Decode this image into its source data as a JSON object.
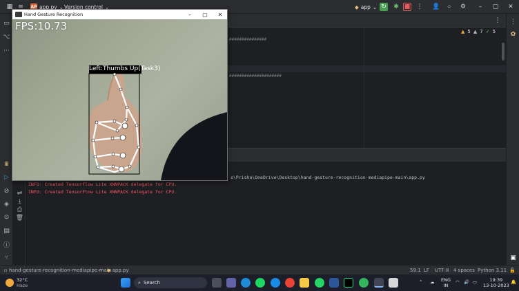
{
  "ide": {
    "project_name": "app.py",
    "project_badge": "AP",
    "version_control": "Version control",
    "run_config": "app",
    "inspections": {
      "warnings": "5",
      "weak_warnings": "7",
      "other": "5"
    }
  },
  "editor": {
    "code_lines": [
      "###############",
      "#####################"
    ]
  },
  "console": {
    "path_line": "s\\Prisha\\OneDrive\\Desktop\\hand-gesture-recognition-mediapipe-main\\app.py",
    "lines": [
      "INFO: Created TensorFlow Lite XNNPACK delegate for CPU.",
      "INFO: Created TensorFlow Lite XNNPACK delegate for CPU."
    ]
  },
  "statusbar": {
    "breadcrumb_project": "hand-gesture-recognition-mediapipe-main",
    "breadcrumb_file": "app.py",
    "position": "59:1",
    "line_sep": "LF",
    "encoding": "UTF-8",
    "indent": "4 spaces",
    "interpreter": "Python 3.11"
  },
  "camera_window": {
    "title": "Hand Gesture Recognition",
    "fps": "FPS:10.73",
    "gesture": "Left:Thumbs Up(Task3)"
  },
  "taskbar": {
    "weather_temp": "32°C",
    "weather_desc": "Haze",
    "search_label": "Search",
    "language": "ENG",
    "region": "IN",
    "time": "19:39",
    "date": "13-10-2023"
  },
  "colors": {
    "ide_bg": "#1e1f22",
    "panel_bg": "#2b2d30",
    "error_text": "#f75464",
    "run_green": "#499c54",
    "stop_red": "#e55b5b"
  }
}
